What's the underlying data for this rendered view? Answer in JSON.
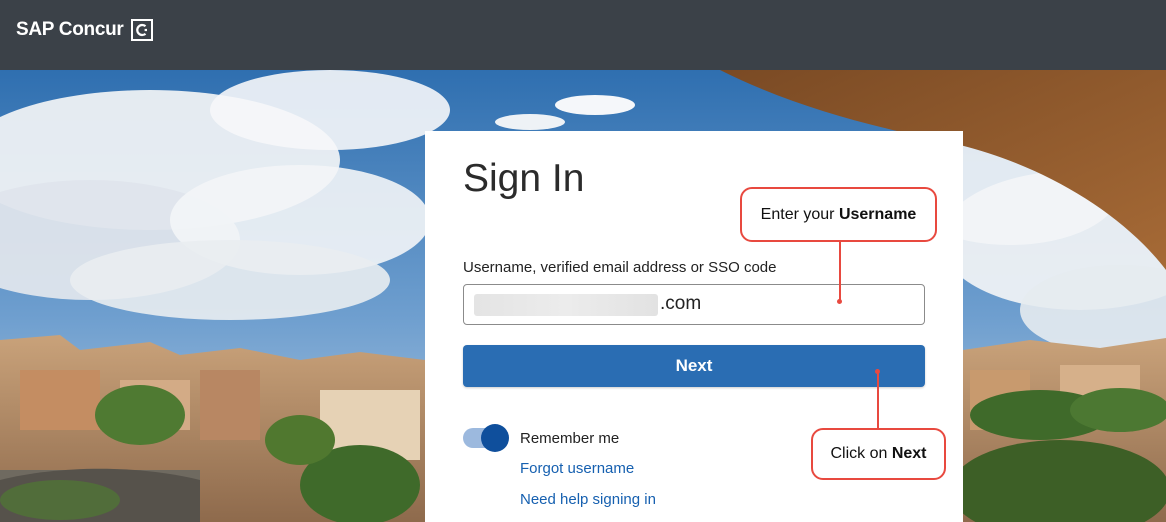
{
  "header": {
    "brand": "SAP Concur",
    "brand_logo_letter": "C"
  },
  "signin": {
    "title": "Sign In",
    "username_label": "Username, verified email address or SSO code",
    "username_value_suffix": ".com",
    "next_label": "Next",
    "remember_me_label": "Remember me",
    "remember_me_on": true,
    "forgot_username_label": "Forgot username",
    "need_help_label": "Need help signing in"
  },
  "callouts": {
    "username_prefix": "Enter your",
    "username_bold": "Username",
    "next_prefix": "Click on",
    "next_bold": "Next"
  },
  "colors": {
    "topbar": "#3b4148",
    "primary_button": "#2a6db3",
    "link": "#1660b0",
    "callout_border": "#e8493f"
  }
}
